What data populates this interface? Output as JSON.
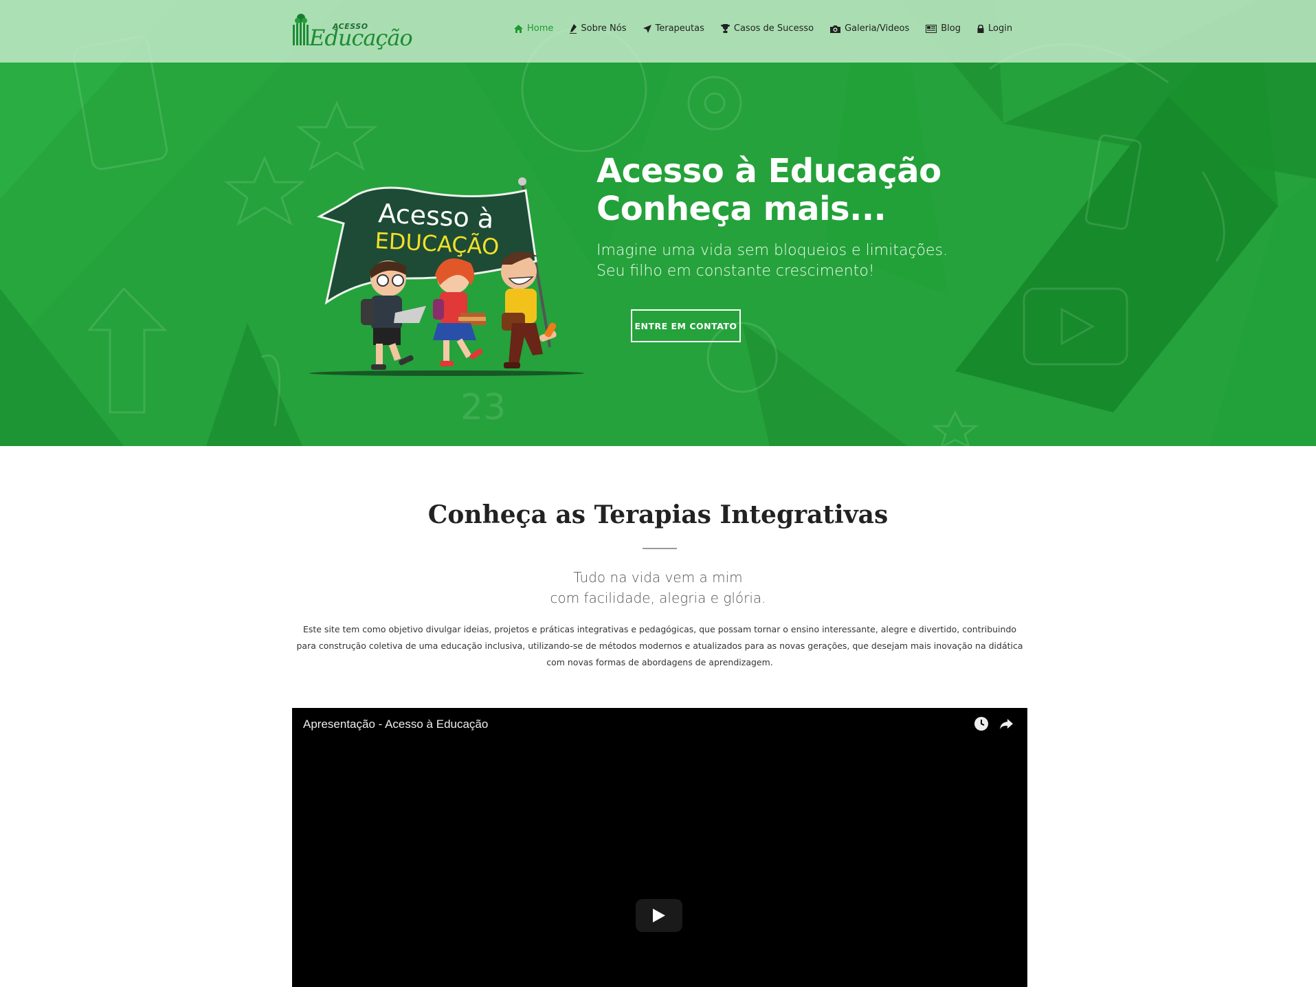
{
  "brand": {
    "logo_top": "ACESSO",
    "logo_main": "Educação"
  },
  "nav": {
    "items": [
      {
        "label": "Home",
        "icon": "home-icon",
        "active": true
      },
      {
        "label": "Sobre Nós",
        "icon": "pen-icon"
      },
      {
        "label": "Terapeutas",
        "icon": "send-icon"
      },
      {
        "label": "Casos de Sucesso",
        "icon": "trophy-icon"
      },
      {
        "label": "Galeria/Videos",
        "icon": "camera-icon"
      },
      {
        "label": "Blog",
        "icon": "newspaper-icon"
      },
      {
        "label": "Login",
        "icon": "lock-icon"
      }
    ]
  },
  "hero": {
    "title_line1": "Acesso à Educação",
    "title_line2": "Conheça mais...",
    "subtitle_line1": "Imagine uma vida sem bloqueios e limitações.",
    "subtitle_line2": "Seu filho em constante crescimento!",
    "cta_label": "ENTRE EM CONTATO",
    "banner_line1": "Acesso à",
    "banner_line2": "EDUCAÇÃO"
  },
  "section": {
    "title": "Conheça as Terapias Integrativas",
    "tagline_line1": "Tudo na vida vem a mim",
    "tagline_line2": "com facilidade, alegria e glória.",
    "body": "Este site tem como objetivo divulgar ideias, projetos e práticas integrativas e pedagógicas, que possam tornar o ensino interessante, alegre e divertido, contribuindo para construção coletiva de uma educação inclusiva, utilizando-se de métodos modernos e atualizados para as novas gerações, que desejam mais inovação na didática com novas formas de abordagens de aprendizagem."
  },
  "video": {
    "title": "Apresentação - Acesso à Educação"
  },
  "colors": {
    "brand_green": "#23a03a",
    "nav_bg": "#c8eccd",
    "active_link": "#1f9a33"
  }
}
